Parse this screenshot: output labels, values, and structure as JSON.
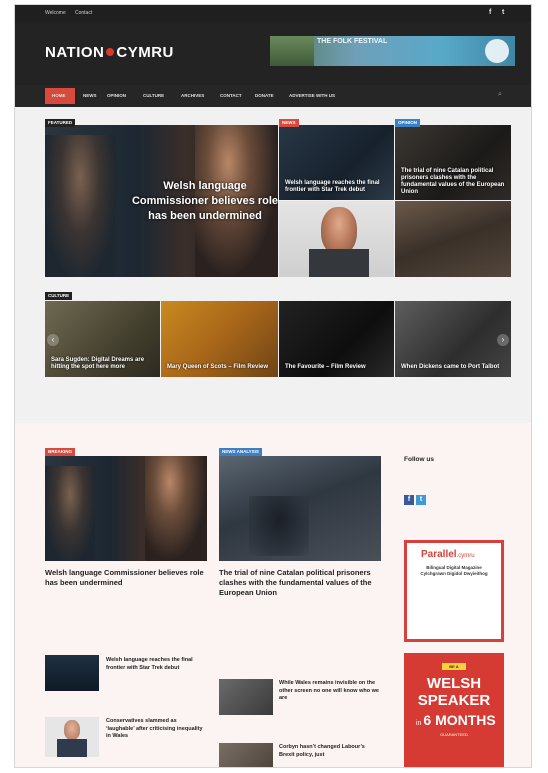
{
  "topbar": {
    "links": [
      "Welcome",
      "Contact"
    ],
    "social": [
      "f",
      "t"
    ]
  },
  "header": {
    "logo_left": "NATION",
    "logo_right": "CYMRU",
    "tagline": "",
    "banner": {
      "line1": "THE FOLK FESTIVAL",
      "line2": "",
      "line3": ""
    }
  },
  "nav": {
    "items": [
      "HOME",
      "NEWS",
      "OPINION",
      "CULTURE",
      "ARCHIVES",
      "CONTACT",
      "DONATE",
      "ADVERTISE WITH US"
    ]
  },
  "featured": {
    "label": "FEATURED",
    "main": {
      "title": "Welsh language Commissioner believes role has been undermined",
      "date": ""
    },
    "tiles": [
      {
        "label": "NEWS",
        "title": "Welsh language reaches the final frontier with Star Trek debut"
      },
      {
        "label": "OPINION",
        "title": "The trial of nine Catalan political prisoners clashes with the fundamental values of the European Union"
      },
      {
        "label": "",
        "title": ""
      },
      {
        "label": "",
        "title": ""
      }
    ]
  },
  "culture": {
    "label": "CULTURE",
    "tiles": [
      {
        "title": "Sara Sugden: Digital Dreams are hitting the spot here more"
      },
      {
        "title": "Mary Queen of Scots – Film Review"
      },
      {
        "title": "The Favourite – Film Review"
      },
      {
        "title": "When Dickens came to Port Talbot"
      }
    ]
  },
  "lower": {
    "col1": {
      "label": "BREAKING",
      "title": "Welsh language Commissioner believes role has been undermined",
      "meta": "",
      "excerpt": "",
      "items": [
        {
          "title": "Welsh language reaches the final frontier with Star Trek debut",
          "meta": ""
        },
        {
          "title": "Conservatives slammed as ‘laughable’ after criticising inequality in Wales",
          "meta": ""
        }
      ]
    },
    "col2": {
      "label": "NEWS ANALYSIS",
      "title": "The trial of nine Catalan political prisoners clashes with the fundamental values of the European Union",
      "meta": "",
      "excerpt": "",
      "items": [
        {
          "title": "While Wales remains invisible on the other screen no one will know who we are",
          "meta": ""
        },
        {
          "title": "Corbyn hasn’t changed Labour’s Brexit policy, just",
          "meta": ""
        }
      ]
    },
    "sidebar": {
      "follow_title": "Follow us",
      "follow_text": "",
      "social": [
        "f",
        "t"
      ],
      "ad1": {
        "brand": "Parallel",
        "brand_suffix": ".cymru",
        "line1": "Bilingual Digital Magazine",
        "line2": "Cylchgrawn Digidol Dwyieithog",
        "small": ""
      },
      "ad2": {
        "badge": "BE A",
        "line1": "WELSH",
        "line2": "SPEAKER",
        "in_word": "in",
        "months": "6 MONTHS",
        "guaranteed": "GUARANTEED",
        "bottom": ""
      }
    }
  }
}
